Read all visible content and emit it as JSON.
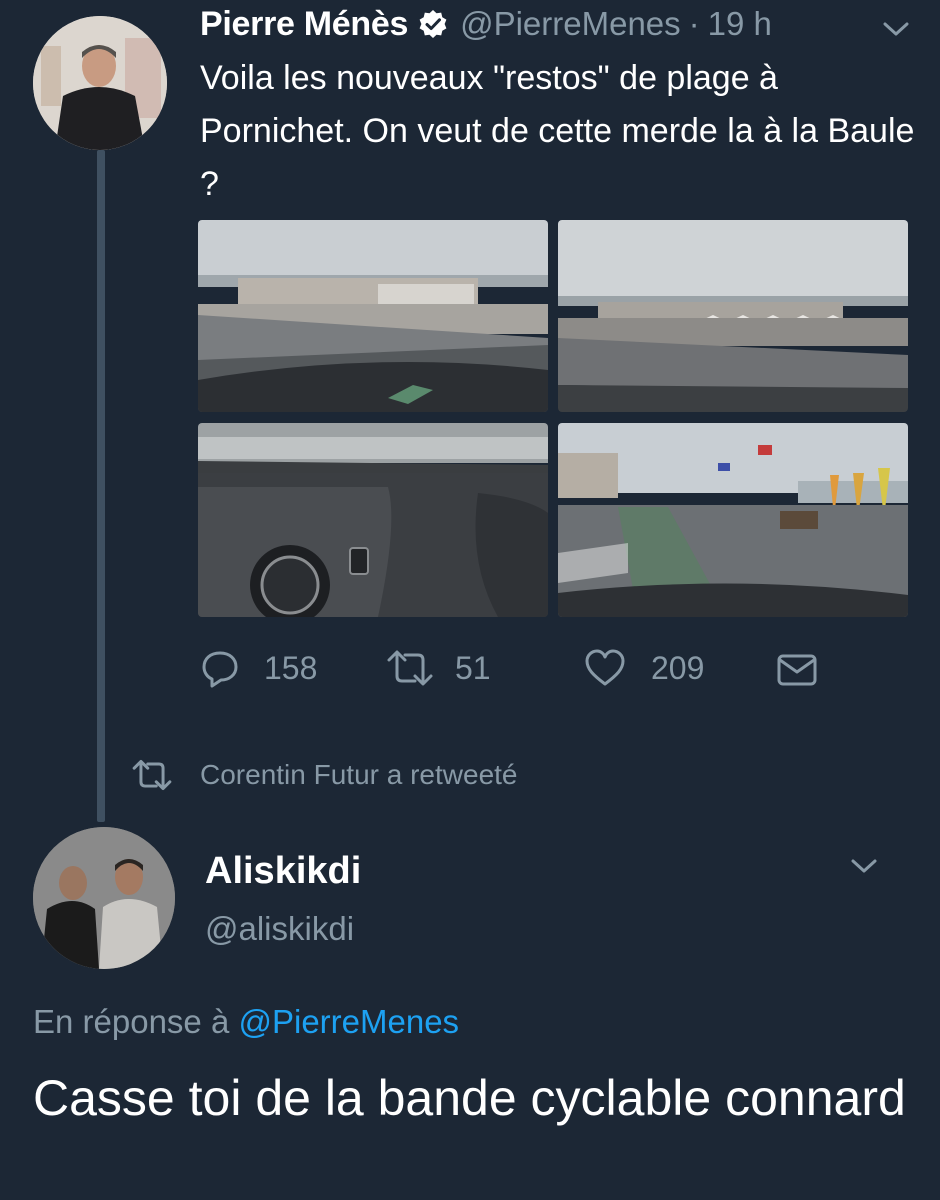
{
  "tweet": {
    "author_name": "Pierre Ménès",
    "handle": "@PierreMenes",
    "separator": "·",
    "time": "19 h",
    "text": "Voila les nouveaux \"restos\" de plage à Pornichet. On veut de cette merde la à la Baule ?",
    "actions": {
      "replies": "158",
      "retweets": "51",
      "likes": "209"
    }
  },
  "retweet_context": {
    "label": "Corentin Futur a retweeté"
  },
  "reply_tweet": {
    "author_name": "Aliskikdi",
    "handle": "@aliskikdi",
    "reply_prefix": "En réponse à",
    "reply_mention": "@PierreMenes",
    "text": "Casse toi de la bande cyclable connard"
  },
  "colors": {
    "background": "#1c2735",
    "text_secondary": "#8899a6",
    "link": "#1da1f2",
    "thread_line": "#3f5061"
  },
  "icons": [
    "verified-badge-icon",
    "chevron-down-icon",
    "reply-icon",
    "retweet-icon",
    "like-icon",
    "direct-message-icon"
  ]
}
